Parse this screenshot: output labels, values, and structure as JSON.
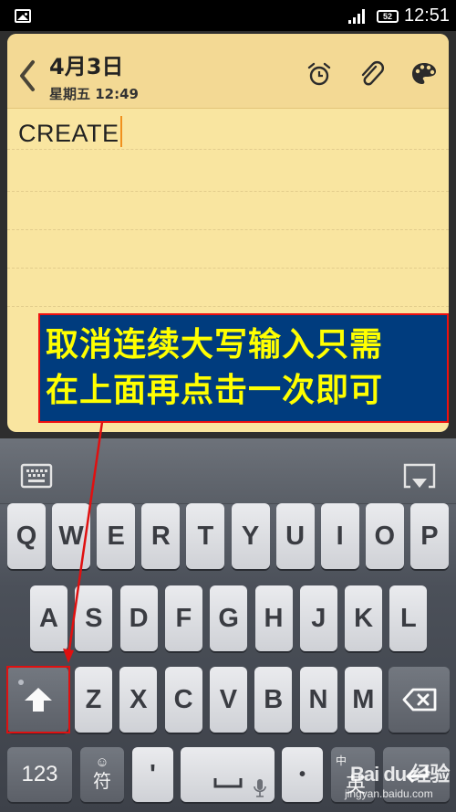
{
  "status_bar": {
    "notification_icon": "image-icon",
    "signal_icon": "signal-icon",
    "battery_level": "52",
    "time": "12:51"
  },
  "note": {
    "back_icon": "chevron-left-icon",
    "date": "4月3日",
    "subtitle": "星期五 12:49",
    "actions": [
      {
        "name": "alarm-icon"
      },
      {
        "name": "paperclip-icon"
      },
      {
        "name": "palette-icon"
      }
    ],
    "content": "CREATE",
    "background_color": "#f9e5a0",
    "caret_color": "#f0901e"
  },
  "annotation": {
    "line1": "取消连续大写输入只需",
    "line2": "在上面再点击一次即可",
    "text_color": "#ffff00",
    "background_color": "#003c7e",
    "border_color": "#e11111"
  },
  "keyboard": {
    "toolbar": {
      "left_icon": "keyboard-icon",
      "right_icon": "hide-keyboard-icon"
    },
    "row1": [
      "Q",
      "W",
      "E",
      "R",
      "T",
      "Y",
      "U",
      "I",
      "O",
      "P"
    ],
    "row2": [
      "A",
      "S",
      "D",
      "F",
      "G",
      "H",
      "J",
      "K",
      "L"
    ],
    "row3": [
      "Z",
      "X",
      "C",
      "V",
      "B",
      "N",
      "M"
    ],
    "shift_icon": "shift-arrow-icon",
    "shift_state": "caps-lock",
    "backspace_icon": "backspace-icon",
    "bottom": {
      "numbers": "123",
      "symbols_emoji": "☺",
      "symbols": "符",
      "apostrophe": "'",
      "space_icon": "space-icon",
      "mic_icon": "microphone-icon",
      "period": "•",
      "lang_top": "中",
      "lang_bottom": "英",
      "enter_icon": "enter-icon"
    }
  },
  "watermark": {
    "brand": "Bai du 经验",
    "url": "jingyan.baidu.com"
  }
}
